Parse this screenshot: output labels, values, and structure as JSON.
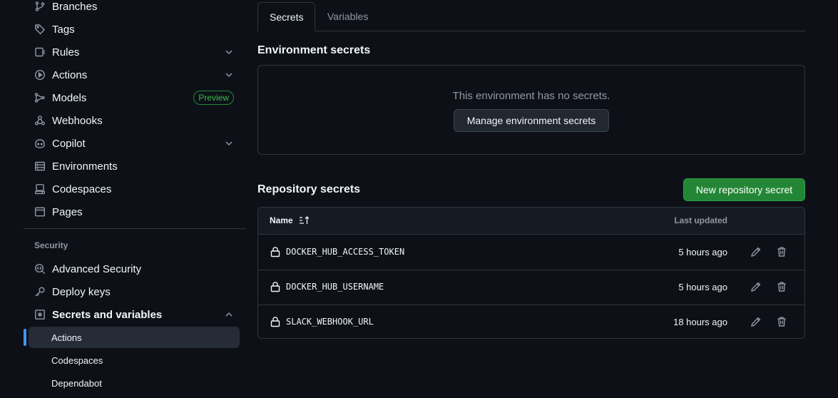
{
  "sidebar": {
    "items": [
      {
        "label": "Branches",
        "icon": "branch-icon"
      },
      {
        "label": "Tags",
        "icon": "tag-icon"
      },
      {
        "label": "Rules",
        "icon": "rules-icon"
      },
      {
        "label": "Actions",
        "icon": "play-icon"
      },
      {
        "label": "Models",
        "icon": "models-icon",
        "badge": "Preview"
      },
      {
        "label": "Webhooks",
        "icon": "webhook-icon"
      },
      {
        "label": "Copilot",
        "icon": "copilot-icon"
      },
      {
        "label": "Environments",
        "icon": "server-icon"
      },
      {
        "label": "Codespaces",
        "icon": "codespaces-icon"
      },
      {
        "label": "Pages",
        "icon": "browser-icon"
      }
    ],
    "security_title": "Security",
    "security_items": [
      {
        "label": "Advanced Security",
        "icon": "codescan-icon"
      },
      {
        "label": "Deploy keys",
        "icon": "key-icon"
      },
      {
        "label": "Secrets and variables",
        "icon": "asterisk-icon"
      }
    ],
    "sub_items": [
      {
        "label": "Actions",
        "active": true
      },
      {
        "label": "Codespaces"
      },
      {
        "label": "Dependabot"
      }
    ]
  },
  "tabs": [
    {
      "label": "Secrets",
      "selected": true
    },
    {
      "label": "Variables"
    }
  ],
  "environment": {
    "title": "Environment secrets",
    "empty_text": "This environment has no secrets.",
    "manage_button": "Manage environment secrets"
  },
  "repository": {
    "title": "Repository secrets",
    "new_button": "New repository secret",
    "col_name": "Name",
    "col_updated": "Last updated",
    "rows": [
      {
        "name": "DOCKER_HUB_ACCESS_TOKEN",
        "updated": "5 hours ago"
      },
      {
        "name": "DOCKER_HUB_USERNAME",
        "updated": "5 hours ago"
      },
      {
        "name": "SLACK_WEBHOOK_URL",
        "updated": "18 hours ago"
      }
    ]
  },
  "colors": {
    "background": "#0d1117",
    "accent": "#4493f8",
    "primary_button": "#238636",
    "preview_badge": "#3fb950"
  }
}
